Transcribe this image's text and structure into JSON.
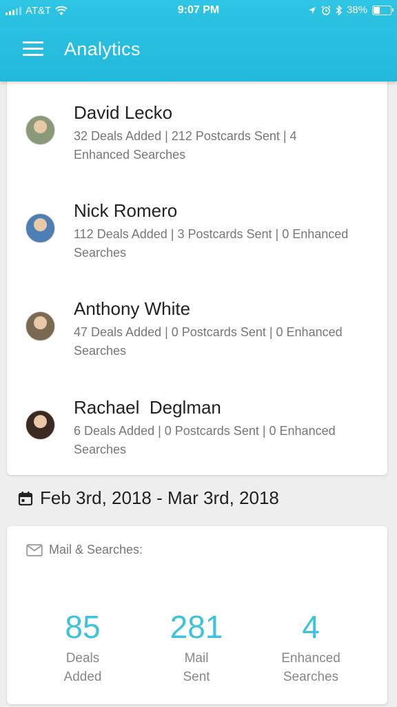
{
  "status_bar": {
    "carrier": "AT&T",
    "time": "9:07 PM",
    "battery": "38%",
    "battery_level": 0.38
  },
  "header": {
    "title": "Analytics",
    "menu_icon": "hamburger-menu-icon"
  },
  "users": [
    {
      "name": "David Lecko",
      "stats": "32 Deals Added | 212 Postcards Sent | 4 Enhanced Searches",
      "avatar_color": "#8a9a78"
    },
    {
      "name": "Nick Romero",
      "stats": "112 Deals Added | 3 Postcards Sent | 0 Enhanced Searches",
      "avatar_color": "#4d7fb5"
    },
    {
      "name": "Anthony White",
      "stats": "47 Deals Added | 0 Postcards Sent | 0 Enhanced Searches",
      "avatar_color": "#7a6a52"
    },
    {
      "name": "Rachael  Deglman",
      "stats": "6 Deals Added | 0 Postcards Sent | 0 Enhanced Searches",
      "avatar_color": "#3a2a22"
    }
  ],
  "date_range": {
    "icon": "calendar-icon",
    "text": "Feb 3rd, 2018 - Mar 3rd, 2018"
  },
  "mail_searches": {
    "icon": "mail-icon",
    "title": "Mail & Searches:",
    "metrics": [
      {
        "value": "85",
        "label_line1": "Deals",
        "label_line2": "Added"
      },
      {
        "value": "281",
        "label_line1": "Mail",
        "label_line2": "Sent"
      },
      {
        "value": "4",
        "label_line1": "Enhanced",
        "label_line2": "Searches"
      }
    ]
  },
  "colors": {
    "header": "#2ec4e4",
    "accent": "#3ec3de",
    "background": "#eeeeee"
  }
}
